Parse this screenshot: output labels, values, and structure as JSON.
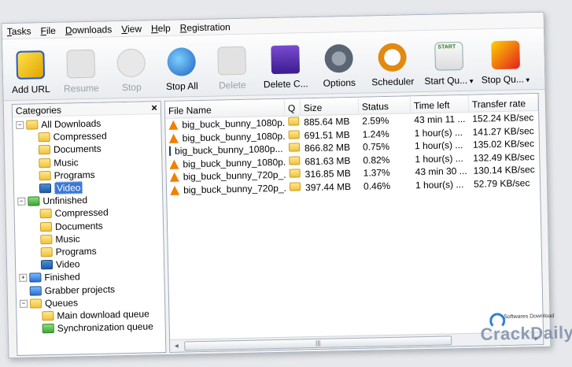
{
  "menu": [
    "Tasks",
    "File",
    "Downloads",
    "View",
    "Help",
    "Registration"
  ],
  "toolbar": [
    {
      "label": "Add URL",
      "icon": "add-url-icon",
      "disabled": false
    },
    {
      "label": "Resume",
      "icon": "resume-icon",
      "disabled": true
    },
    {
      "label": "Stop",
      "icon": "stop-icon",
      "disabled": true
    },
    {
      "label": "Stop All",
      "icon": "stop-all-icon",
      "disabled": false
    },
    {
      "label": "Delete",
      "icon": "delete-icon",
      "disabled": true
    },
    {
      "label": "Delete C...",
      "icon": "delete-completed-icon",
      "disabled": false
    },
    {
      "label": "Options",
      "icon": "options-icon",
      "disabled": false
    },
    {
      "label": "Scheduler",
      "icon": "scheduler-icon",
      "disabled": false
    },
    {
      "label": "Start Qu...",
      "icon": "start-queue-icon",
      "disabled": false,
      "icon_text": "START"
    },
    {
      "label": "Stop Qu...",
      "icon": "stop-queue-icon",
      "disabled": false
    }
  ],
  "categories": {
    "title": "Categories",
    "close": "×",
    "tree": [
      {
        "label": "All Downloads",
        "level": 0,
        "toggle": "−",
        "icon": "folder"
      },
      {
        "label": "Compressed",
        "level": 1,
        "icon": "folder"
      },
      {
        "label": "Documents",
        "level": 1,
        "icon": "folder"
      },
      {
        "label": "Music",
        "level": 1,
        "icon": "folder"
      },
      {
        "label": "Programs",
        "level": 1,
        "icon": "folder"
      },
      {
        "label": "Video",
        "level": 1,
        "icon": "video",
        "selected": true
      },
      {
        "label": "Unfinished",
        "level": 0,
        "toggle": "−",
        "icon": "green"
      },
      {
        "label": "Compressed",
        "level": 1,
        "icon": "folder"
      },
      {
        "label": "Documents",
        "level": 1,
        "icon": "folder"
      },
      {
        "label": "Music",
        "level": 1,
        "icon": "folder"
      },
      {
        "label": "Programs",
        "level": 1,
        "icon": "folder"
      },
      {
        "label": "Video",
        "level": 1,
        "icon": "video"
      },
      {
        "label": "Finished",
        "level": 0,
        "toggle": "+",
        "icon": "blue"
      },
      {
        "label": "Grabber projects",
        "level": 0,
        "icon": "blue"
      },
      {
        "label": "Queues",
        "level": 0,
        "toggle": "−",
        "icon": "folder"
      },
      {
        "label": "Main download queue",
        "level": 1,
        "icon": "folder"
      },
      {
        "label": "Synchronization queue",
        "level": 1,
        "icon": "green"
      }
    ]
  },
  "columns": [
    "File Name",
    "Q",
    "Size",
    "Status",
    "Time left",
    "Transfer rate"
  ],
  "rows": [
    {
      "name": "big_buck_bunny_1080p...",
      "icon": "vlc",
      "size": "885.64  MB",
      "status": "2.59%",
      "time": "43 min 11 ...",
      "rate": "152.24  KB/sec"
    },
    {
      "name": "big_buck_bunny_1080p...",
      "icon": "vlc",
      "size": "691.51  MB",
      "status": "1.24%",
      "time": "1 hour(s) ...",
      "rate": "141.27  KB/sec"
    },
    {
      "name": "big_buck_bunny_1080p...",
      "icon": "media",
      "size": "866.82  MB",
      "status": "0.75%",
      "time": "1 hour(s) ...",
      "rate": "135.02  KB/sec"
    },
    {
      "name": "big_buck_bunny_1080p...",
      "icon": "vlc",
      "size": "681.63  MB",
      "status": "0.82%",
      "time": "1 hour(s) ...",
      "rate": "132.49  KB/sec"
    },
    {
      "name": "big_buck_bunny_720p_...",
      "icon": "vlc",
      "size": "316.85  MB",
      "status": "1.37%",
      "time": "43 min 30 ...",
      "rate": "130.14  KB/sec"
    },
    {
      "name": "big_buck_bunny_720p_...",
      "icon": "vlc",
      "size": "397.44  MB",
      "status": "0.46%",
      "time": "1 hour(s) ...",
      "rate": "52.79  KB/sec"
    }
  ],
  "scrollbar": {
    "left": "◄",
    "grip": "|||",
    "right": "►"
  },
  "watermark": {
    "small": "Softwares Download",
    "big": "CrackDaily"
  }
}
